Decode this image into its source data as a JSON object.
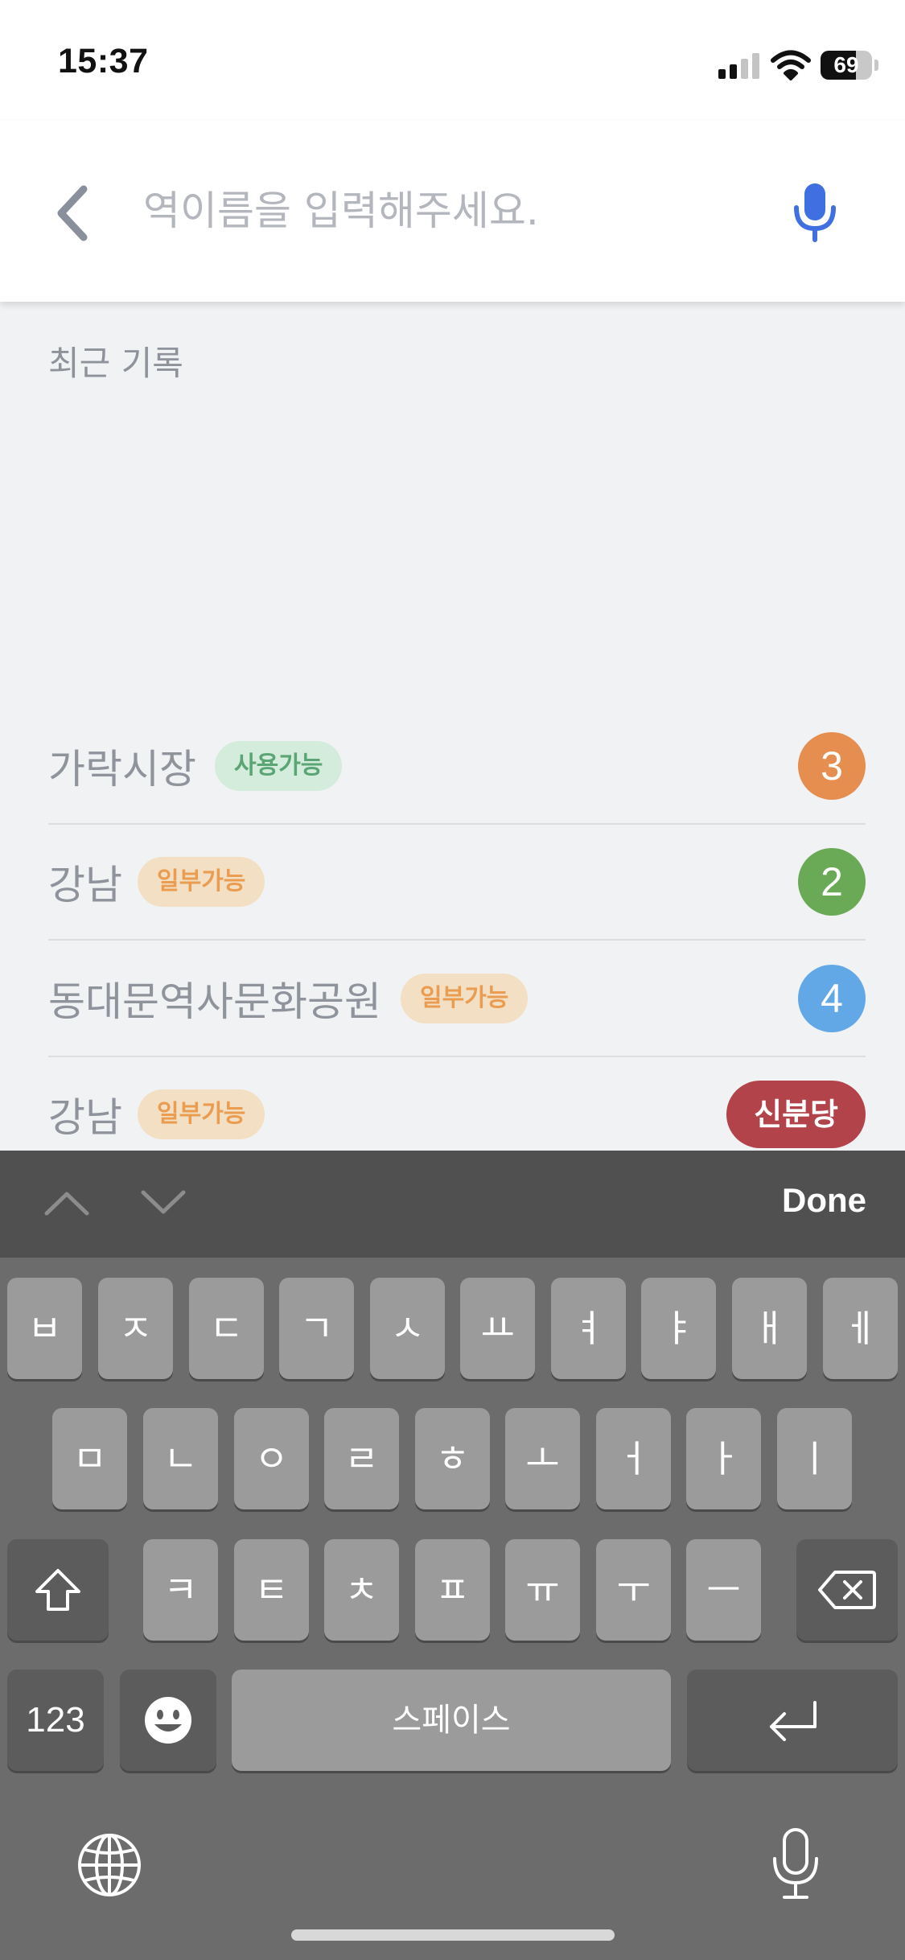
{
  "status_bar": {
    "time": "15:37",
    "battery_level": "69",
    "battery_fraction": 0.69,
    "icons": [
      "signal-icon",
      "wifi-icon",
      "battery-icon"
    ]
  },
  "search": {
    "placeholder": "역이름을 입력해주세요.",
    "value": "",
    "back_icon": "chevron-left-icon",
    "mic_icon": "microphone-icon",
    "colors": {
      "back": "#8a909b",
      "mic": "#3f6fe0"
    }
  },
  "recent": {
    "title": "최근 기록",
    "items": [
      {
        "name": "가락시장",
        "status": "사용가능",
        "status_type": "available",
        "line": "3",
        "line_color": "#e68d50"
      },
      {
        "name": "강남",
        "status": "일부가능",
        "status_type": "partial",
        "line": "2",
        "line_color": "#6aaa57"
      },
      {
        "name": "동대문역사문화공원",
        "status": "일부가능",
        "status_type": "partial",
        "line": "4",
        "line_color": "#62a8e6"
      },
      {
        "name": "강남",
        "status": "일부가능",
        "status_type": "partial",
        "line": "신분당",
        "line_color": "#b2434a"
      }
    ]
  },
  "keyboard": {
    "accessory": {
      "done_label": "Done",
      "prev_icon": "chevron-up-icon",
      "next_icon": "chevron-down-icon"
    },
    "rows": [
      [
        "ㅂ",
        "ㅈ",
        "ㄷ",
        "ㄱ",
        "ㅅ",
        "ㅛ",
        "ㅕ",
        "ㅑ",
        "ㅐ",
        "ㅔ"
      ],
      [
        "ㅁ",
        "ㄴ",
        "ㅇ",
        "ㄹ",
        "ㅎ",
        "ㅗ",
        "ㅓ",
        "ㅏ",
        "ㅣ"
      ],
      [
        "ㅋ",
        "ㅌ",
        "ㅊ",
        "ㅍ",
        "ㅠ",
        "ㅜ",
        "ㅡ"
      ]
    ],
    "numbers_label": "123",
    "space_label": "스페이스",
    "icons": [
      "shift-icon",
      "backspace-icon",
      "emoji-icon",
      "return-icon",
      "globe-icon",
      "dictation-icon"
    ]
  }
}
